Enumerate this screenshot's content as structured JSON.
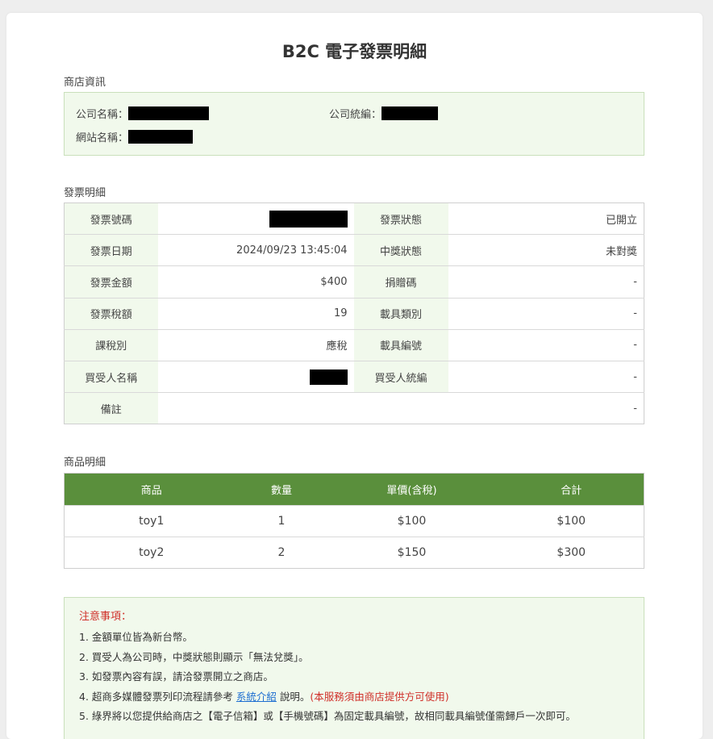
{
  "title": "B2C 電子發票明細",
  "store": {
    "section_label": "商店資訊",
    "company_name_label": "公司名稱：",
    "company_id_label": "公司統編：",
    "website_name_label": "網站名稱："
  },
  "invoice": {
    "section_label": "發票明細",
    "rows": [
      {
        "l1": "發票號碼",
        "v1": "",
        "l2": "發票狀態",
        "v2": "已開立"
      },
      {
        "l1": "發票日期",
        "v1": "2024/09/23 13:45:04",
        "l2": "中獎狀態",
        "v2": "未對獎"
      },
      {
        "l1": "發票金額",
        "v1": "$400",
        "l2": "捐贈碼",
        "v2": "-"
      },
      {
        "l1": "發票稅額",
        "v1": "19",
        "l2": "載具類別",
        "v2": "-"
      },
      {
        "l1": "課稅別",
        "v1": "應稅",
        "l2": "載具編號",
        "v2": "-"
      },
      {
        "l1": "買受人名稱",
        "v1": "",
        "l2": "買受人統編",
        "v2": "-"
      },
      {
        "l1": "備註",
        "v1": "-"
      }
    ]
  },
  "items": {
    "section_label": "商品明細",
    "headers": [
      "商品",
      "數量",
      "單價(含稅)",
      "合計"
    ],
    "rows": [
      [
        "toy1",
        "1",
        "$100",
        "$100"
      ],
      [
        "toy2",
        "2",
        "$150",
        "$300"
      ]
    ]
  },
  "notes": {
    "title": "注意事項：",
    "items": [
      "1. 金額單位皆為新台幣。",
      "2. 買受人為公司時，中獎狀態則顯示「無法兌獎」。",
      "3. 如發票內容有誤，請洽發票開立之商店。",
      "4. 超商多媒體發票列印流程請參考",
      "5. 綠界將以您提供給商店之【電子信箱】或【手機號碼】為固定載具編號，故相同載具編號僅需歸戶一次即可。"
    ],
    "item4_link": "系統介紹",
    "item4_suffix": "說明。",
    "item4_red": "(本服務須由商店提供方可使用)"
  },
  "colors": {
    "accent_green": "#5a8f3c",
    "light_green": "#f1f9ec",
    "warning_red": "#d0302a",
    "link_blue": "#1f6fd1"
  }
}
